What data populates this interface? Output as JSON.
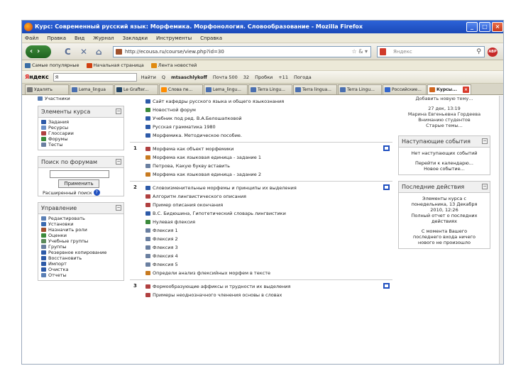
{
  "window": {
    "title": "Курс: Современный русский язык: Морфемика. Морфонология. Словообразование - Mozilla Firefox",
    "buttons": [
      "_",
      "□",
      "×"
    ]
  },
  "menu": [
    "Файл",
    "Правка",
    "Вид",
    "Журнал",
    "Закладки",
    "Инструменты",
    "Справка"
  ],
  "nav": {
    "back_forward": "‹›",
    "reload_icon": "C",
    "stop_icon": "✕",
    "home_icon": "⌂",
    "url": "http://ecousa.ru/course/view.php?id=30",
    "url_star": "☆ &  ▾",
    "search_placeholder": "Яндекс",
    "search_glyph": "⚲",
    "addon_badge": "ABP"
  },
  "bookmarks": [
    {
      "label": "Самые популярные",
      "color": "#3a6ea5"
    },
    {
      "label": "Начальная страница",
      "color": "#d04010"
    },
    {
      "label": "Лента новостей",
      "color": "#e08a10"
    }
  ],
  "yandex": {
    "logo_first": "Я",
    "logo_rest": "ндекс",
    "input_value": "Я",
    "items": [
      "Найти",
      "Q",
      "mtsaschlykoff",
      "Почта 500",
      "32",
      "Пробки",
      "+11",
      "Погода"
    ]
  },
  "tabs": [
    {
      "label": "Удалять",
      "color": "#777",
      "active": false
    },
    {
      "label": "Lema_lingua",
      "color": "#4a6fb0",
      "active": false
    },
    {
      "label": "Le Grafter...",
      "color": "#224466",
      "active": false
    },
    {
      "label": "Слова пе...",
      "color": "#ff8c00",
      "active": false
    },
    {
      "label": "Lema_lingu...",
      "color": "#4a6fb0",
      "active": false
    },
    {
      "label": "Terra Lingu...",
      "color": "#4a6fb0",
      "active": false
    },
    {
      "label": "Terra lingua...",
      "color": "#4a6fb0",
      "active": false
    },
    {
      "label": "Terra Lingu...",
      "color": "#4a6fb0",
      "active": false
    },
    {
      "label": "Российские...",
      "color": "#3366cc",
      "active": false
    },
    {
      "label": "Курсы...",
      "color": "#d0661e",
      "active": true
    }
  ],
  "left": {
    "participants": "Участники",
    "course_elements": {
      "title": "Элементы курса",
      "items": [
        "Задания",
        "Ресурсы",
        "Глоссарии",
        "Форумы",
        "Тесты"
      ]
    },
    "forum_search": {
      "title": "Поиск по форумам",
      "button": "Применить",
      "advanced": "Расширенный поиск"
    },
    "admin": {
      "title": "Управление",
      "items": [
        "Редактировать",
        "Установки",
        "Назначить роли",
        "Оценки",
        "Учебные группы",
        "Группы",
        "Резервное копирование",
        "Восстановить",
        "Импорт",
        "Очистка",
        "Отчеты"
      ]
    }
  },
  "main": {
    "intro": [
      "Сайт кафедры русского языка и общего языкознания",
      "Новостной форум",
      "Учебник под ред. В.А.Белошапковой",
      "Русская грамматика 1980",
      "Морфемика. Методическое пособие."
    ],
    "topics": [
      {
        "num": "1",
        "items": [
          "Морфема как объект морфемики",
          "Морфема как языковая единица - задание 1",
          "Петрова, Какую букву вставить",
          "Морфема как языковая единица - задание 2"
        ]
      },
      {
        "num": "2",
        "items": [
          "Словоизменительные морфемы и принципы их выделения",
          "Алгоритм лингвистического описания",
          "Пример описания окончания",
          "В.С. Бидюшина, Гипотетический словарь лингвистики",
          "Нулевая флексия",
          "Флексия 1",
          "Флексия 2",
          "Флексия 3",
          "Флексия 4",
          "Флексия 5",
          "Определи анализ флексийных морфем в тексте"
        ]
      },
      {
        "num": "3",
        "items": [
          "Формообразующие аффиксы и трудности их выделения",
          "Примеры неоднозначного членения основы в словах"
        ]
      }
    ]
  },
  "right": {
    "add_topic": "Добавить новую тему...",
    "news": [
      "27 дек, 13:19",
      "Марина Евгеньевна Гордеева",
      "Вниманию студентов",
      "Старые темы..."
    ],
    "upcoming": {
      "title": "Наступающие события",
      "body": [
        "Нет наступающих событий",
        "Перейти к календарю...",
        "Новое событие..."
      ]
    },
    "recent": {
      "title": "Последние действия",
      "body": [
        "Элементы курса с",
        "понедельника, 13 Декабря",
        "2010, 12:26",
        "Полный отчет о последних",
        "действиях",
        "С момента Вашего",
        "последнего входа ничего",
        "нового не произошло"
      ]
    },
    "colors": {
      "accent": "#2050c0",
      "brand": "#1a49b8"
    }
  }
}
